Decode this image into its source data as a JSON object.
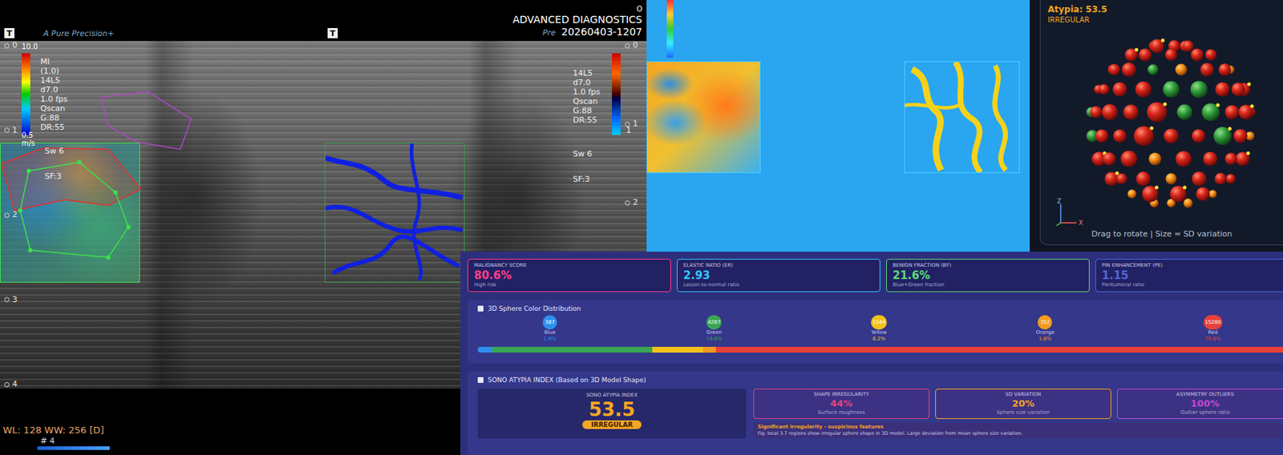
{
  "viewer": {
    "brand": "A Pure Precision+",
    "brand_cut": "Pre",
    "title": "ADVANCED DIAGNOSTICS",
    "timestamp": "20260403-1207",
    "corner_mark": "O",
    "elasto_frame": {
      "tool": "T",
      "colorbar_label": "10.0",
      "params": [
        "MI",
        "(1.0)",
        "14L5",
        "d7.0",
        "1.0 fps",
        "Qscan",
        "G:88",
        "DR:55"
      ],
      "speed_value": "0.5",
      "speed_unit": "m/s",
      "settings": [
        "Sw 6",
        "SF:3"
      ],
      "depth_labels": [
        "0",
        "1",
        "2",
        "3",
        "4"
      ]
    },
    "flow_frame": {
      "tool": "T",
      "colorbar_label": "1",
      "params": [
        "14L5",
        "d7.0",
        "1.0 fps",
        "Qscan",
        "G:88",
        "DR:55"
      ],
      "settings": [
        "Sw 6",
        "SF:3"
      ],
      "depth_labels": [
        "0",
        "1",
        "2"
      ]
    },
    "footer": {
      "window_level": "WL: 128 WW: 256 [D]",
      "frame": "# 4"
    }
  },
  "sphere_panel": {
    "title": "Atypia: 53.5",
    "status": "IRREGULAR",
    "axes": [
      "Z",
      "X"
    ],
    "hint": "Drag to rotate | Size = SD variation"
  },
  "dashboard": {
    "metrics": [
      {
        "label": "MALIGNANCY SCORE",
        "value": "80.6%",
        "sub": "High risk",
        "color": "#ff3f86"
      },
      {
        "label": "ELASTIC RATIO (ER)",
        "value": "2.93",
        "sub": "Lesion-to-normal ratio",
        "color": "#37c6ff"
      },
      {
        "label": "BENIGN FRACTION (BF)",
        "value": "21.6%",
        "sub": "Blue+Green fraction",
        "color": "#5bdc78"
      },
      {
        "label": "PIN ENHANCEMENT (PE)",
        "value": "1.15",
        "sub": "Peritumoral ratio",
        "color": "#4f68d8"
      }
    ],
    "distribution": {
      "title": "3D Sphere Color Distribution",
      "items": [
        {
          "name": "Blue",
          "count": "387",
          "percent": "1.8%",
          "color": "#2f8ff0"
        },
        {
          "name": "Green",
          "count": "4287",
          "percent": "19.8%",
          "color": "#3aa655"
        },
        {
          "name": "Yellow",
          "count": "1344",
          "percent": "6.2%",
          "color": "#f2c21b"
        },
        {
          "name": "Orange",
          "count": "352",
          "percent": "1.6%",
          "color": "#f39a1e"
        },
        {
          "name": "Red",
          "count": "15280",
          "percent": "70.6%",
          "color": "#e8413a"
        }
      ]
    },
    "atypia": {
      "title": "SONO ATYPIA INDEX (Based on 3D Model Shape)",
      "label": "SONO ATYPIA INDEX",
      "value": "53.5",
      "badge": "IRREGULAR",
      "cards": [
        {
          "label": "SHAPE IRREGULARITY",
          "value": "44%",
          "sub": "Surface roughness",
          "color": "#e0467e"
        },
        {
          "label": "SD VARIATION",
          "value": "20%",
          "sub": "Sphere size variation",
          "color": "#f5a524"
        },
        {
          "label": "ASYMMETRY OUTLIERS",
          "value": "100%",
          "sub": "Outlier sphere ratio",
          "color": "#c04ad0"
        }
      ],
      "finding": "Significant irregularity - suspicious features",
      "detail": "Fig: local 3.7 regions show irregular sphere shape in 3D model. Large deviation from mean sphere size variation."
    }
  }
}
